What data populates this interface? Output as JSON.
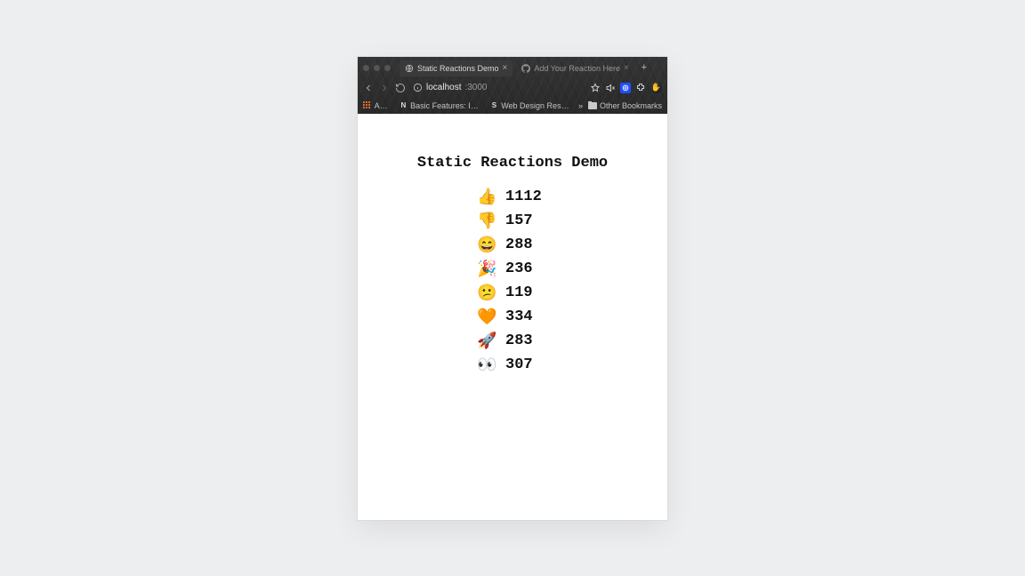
{
  "browser": {
    "tabs": [
      {
        "label": "Static Reactions Demo",
        "active": true,
        "favicon": "globe-icon"
      },
      {
        "label": "Add Your Reaction Here",
        "active": false,
        "favicon": "github-icon"
      }
    ],
    "address": {
      "host": "localhost",
      "port": ":3000"
    },
    "bookmarks_bar": {
      "apps_label": "Apps",
      "items": [
        {
          "icon": "letter-n-icon",
          "label": "Basic Features: Im…"
        },
        {
          "icon": "letter-s-icon",
          "label": "Web Design Reso…"
        }
      ],
      "overflow_glyph": "»",
      "other_label": "Other Bookmarks"
    }
  },
  "page": {
    "title": "Static Reactions Demo",
    "reactions": [
      {
        "emoji": "👍",
        "name": "thumbs-up",
        "count": 1112
      },
      {
        "emoji": "👎",
        "name": "thumbs-down",
        "count": 157
      },
      {
        "emoji": "😄",
        "name": "laugh",
        "count": 288
      },
      {
        "emoji": "🎉",
        "name": "tada",
        "count": 236
      },
      {
        "emoji": "😕",
        "name": "confused",
        "count": 119
      },
      {
        "emoji": "🧡",
        "name": "heart",
        "count": 334
      },
      {
        "emoji": "🚀",
        "name": "rocket",
        "count": 283
      },
      {
        "emoji": "👀",
        "name": "eyes",
        "count": 307
      }
    ]
  }
}
